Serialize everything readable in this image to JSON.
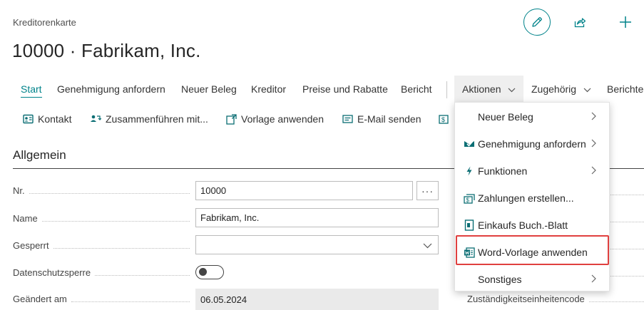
{
  "breadcrumb": "Kreditorenkarte",
  "page_title": "10000 · Fabrikam, Inc.",
  "action_bar": {
    "tabs": [
      {
        "label": "Start",
        "active": true
      },
      {
        "label": "Genehmigung anfordern"
      },
      {
        "label": "Neuer Beleg"
      },
      {
        "label": "Kreditor"
      },
      {
        "label": "Preise und Rabatte"
      },
      {
        "label": "Bericht"
      },
      {
        "label": "Aktionen",
        "open": true
      },
      {
        "label": "Zugehörig"
      },
      {
        "label": "Berichte"
      }
    ]
  },
  "promoted": {
    "contact": "Kontakt",
    "merge": "Zusammenführen mit...",
    "apply_template": "Vorlage anwenden",
    "send_email": "E-Mail senden"
  },
  "section": {
    "title": "Allgemein"
  },
  "fields": {
    "no_label": "Nr.",
    "no_value": "10000",
    "assist_label": "···",
    "name_label": "Name",
    "name_value": "Fabrikam, Inc.",
    "blocked_label": "Gesperrt",
    "blocked_value": "",
    "privacy_label": "Datenschutzsperre",
    "privacy_on": false,
    "changed_label": "Geändert am",
    "changed_value": "06.05.2024",
    "responsibility_label": "Zuständigkeitseinheitencode"
  },
  "actions_menu": {
    "items": [
      {
        "label": "Neuer Beleg",
        "icon": "none",
        "submenu": true
      },
      {
        "label": "Genehmigung anfordern",
        "icon": "approval-icon",
        "submenu": true
      },
      {
        "label": "Funktionen",
        "icon": "lightning-icon",
        "submenu": true
      },
      {
        "label": "Zahlungen erstellen...",
        "icon": "payments-icon",
        "submenu": false
      },
      {
        "label": "Einkaufs Buch.-Blatt",
        "icon": "journal-icon",
        "submenu": false
      },
      {
        "label": "Word-Vorlage anwenden",
        "icon": "word-icon",
        "submenu": false,
        "highlighted": true
      },
      {
        "label": "Sonstiges",
        "icon": "none",
        "submenu": true
      }
    ]
  },
  "colors": {
    "accent": "#00838a",
    "highlight_border": "#e0403f"
  }
}
